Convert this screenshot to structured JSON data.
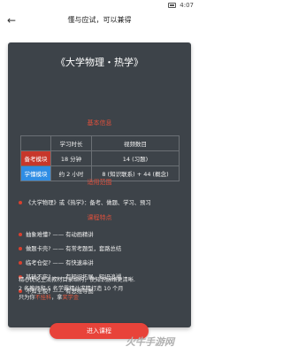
{
  "status_bar": {
    "time": "4:07"
  },
  "header": {
    "title": "懂与应试，可以兼得"
  },
  "card": {
    "course_title": "《大学物理・热学》",
    "basic_info_label": "基本信息",
    "table": {
      "headers": [
        "学习时长",
        "视频数目"
      ],
      "rows": [
        {
          "label": "备考模块",
          "duration": "18 分钟",
          "videos": "14 (习题)"
        },
        {
          "label": "学懂模块",
          "duration": "约 2 小时",
          "videos": "8 (知识联系) + 44 (概念)"
        }
      ]
    },
    "scope_label": "适用范围",
    "scope_text": "《大学物理》或《热学》：备考、做题、学习、预习",
    "features_label": "课程特点",
    "features": [
      {
        "q": "抽象难懂?",
        "a": "有动画精讲"
      },
      {
        "q": "做题卡壳?",
        "a": "有常考题型，套路总结"
      },
      {
        "q": "临考仓促?",
        "a": "有快速串讲"
      },
      {
        "q": "基础不牢?",
        "a": "有知识拓展，知识追溯"
      },
      {
        "q": "不知全貌?",
        "a": "有思维导图"
      }
    ],
    "summary": {
      "line1": "精心优化主流教材目录结构，使知识脉络更清晰.",
      "line2": "2 名教师和 5 名学霸精益求精打造 10 个月",
      "line3_prefix": "只为你",
      "line3_hl1": "不挂科",
      "line3_mid": "，拿",
      "line3_hl2": "奖学金"
    }
  },
  "enter_button": {
    "label": "进入课程"
  },
  "watermark": {
    "text": "火牛手游网"
  },
  "colors": {
    "card_bg": "#3d4349",
    "accent_red": "#e0503c",
    "blue": "#2f8de4",
    "button": "#e8433a"
  }
}
